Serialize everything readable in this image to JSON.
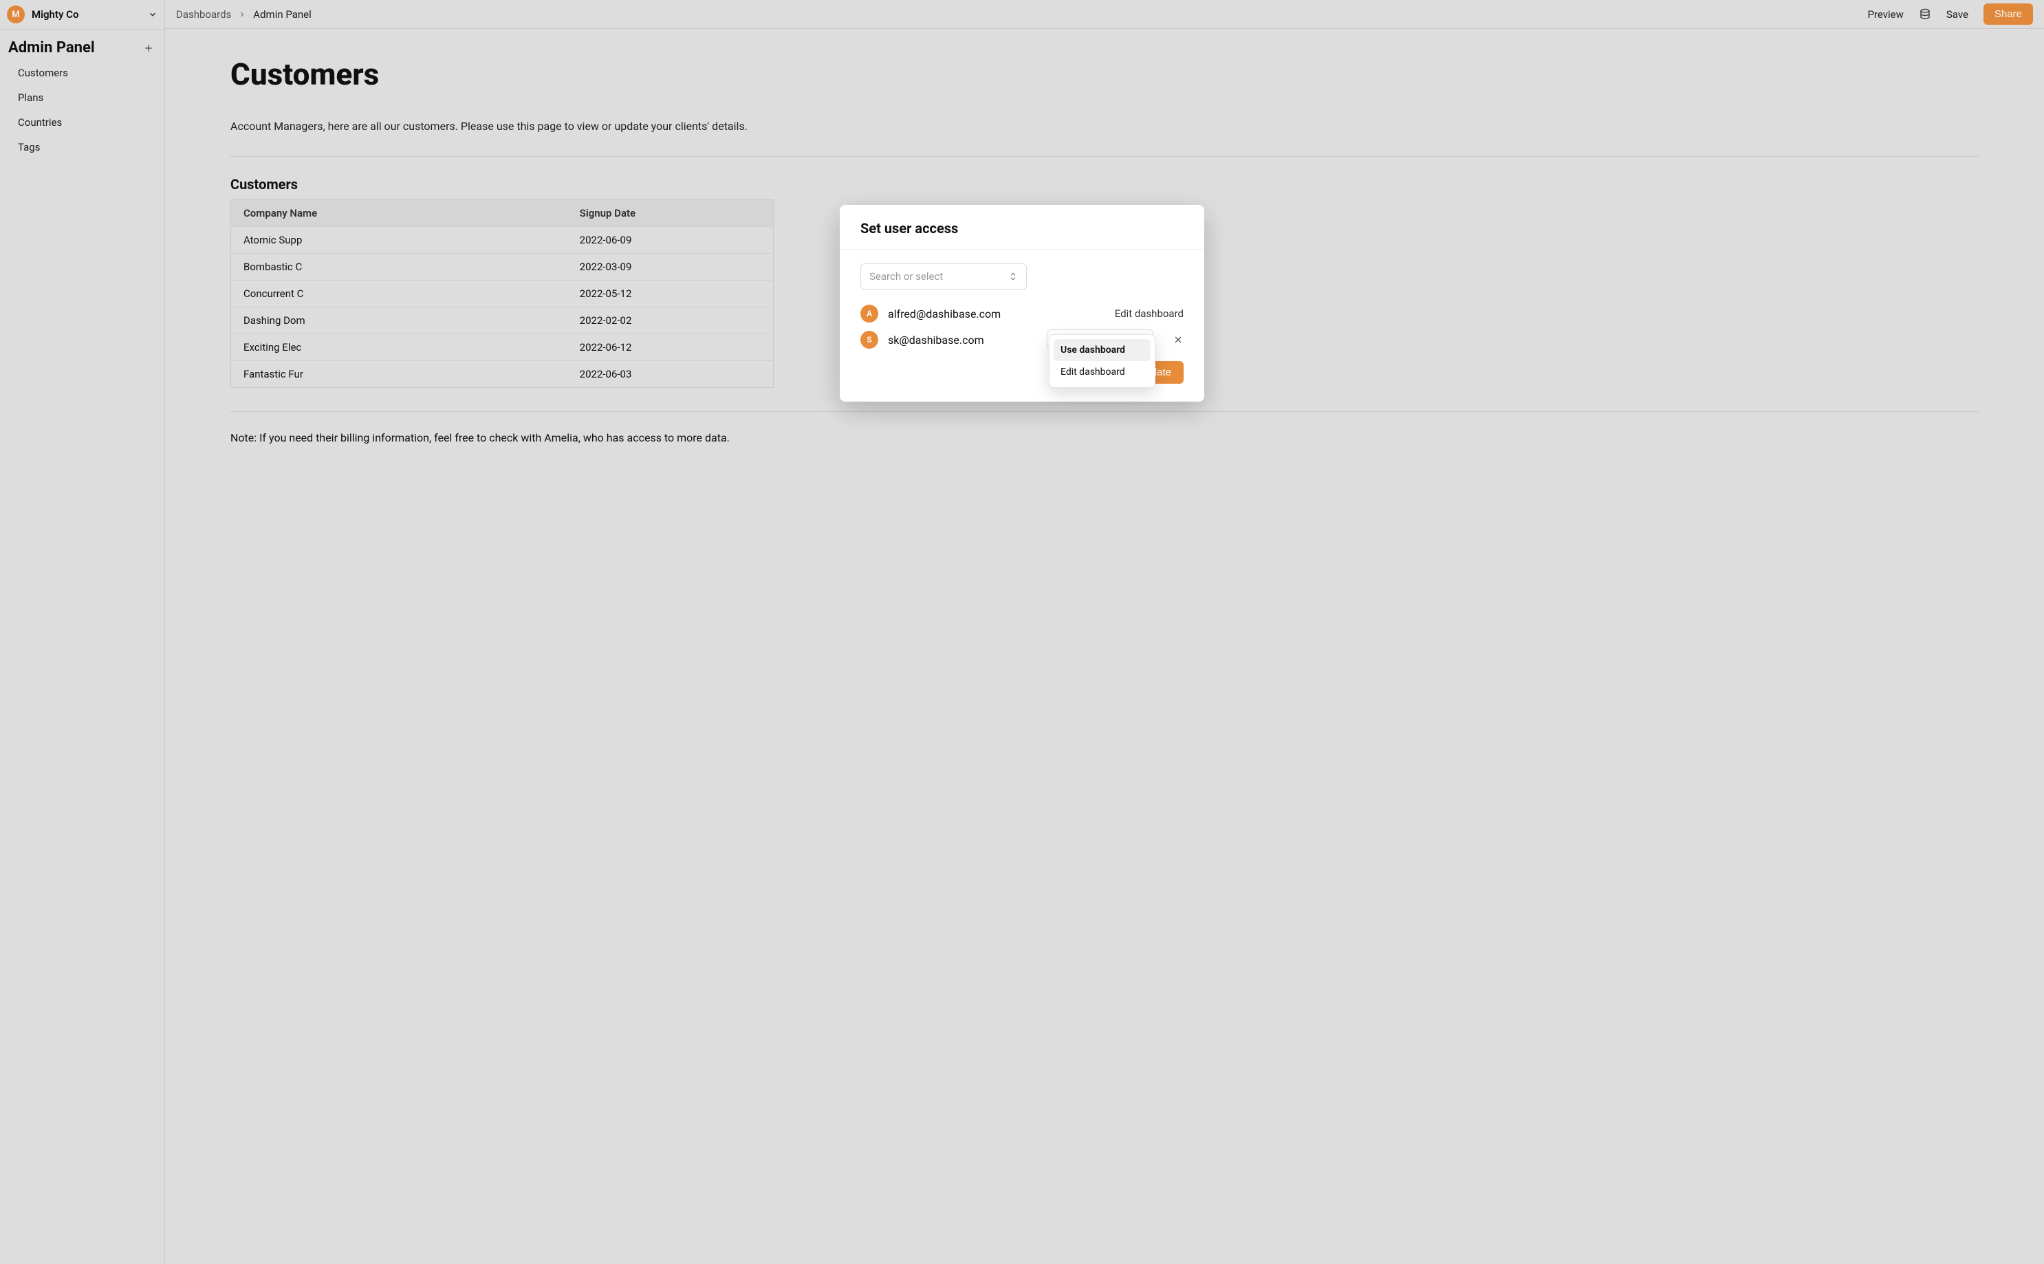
{
  "workspace": {
    "initial": "M",
    "name": "Mighty Co"
  },
  "sidebar": {
    "title": "Admin Panel",
    "items": [
      "Customers",
      "Plans",
      "Countries",
      "Tags"
    ]
  },
  "breadcrumb": {
    "root": "Dashboards",
    "current": "Admin Panel"
  },
  "topbar": {
    "preview": "Preview",
    "save": "Save",
    "share": "Share"
  },
  "page": {
    "title": "Customers",
    "intro": "Account Managers, here are all our customers. Please use this page to view or update your clients' details.",
    "section": "Customers",
    "note": "Note: If you need their billing information, feel free to check with Amelia, who has access to more data."
  },
  "table": {
    "columns": [
      "Company Name",
      "Signup Date"
    ],
    "rows": [
      {
        "company": "Atomic Supp",
        "date": "2022-06-09"
      },
      {
        "company": "Bombastic C",
        "date": "2022-03-09"
      },
      {
        "company": "Concurrent C",
        "date": "2022-05-12"
      },
      {
        "company": "Dashing Dom",
        "date": "2022-02-02"
      },
      {
        "company": "Exciting Elec",
        "date": "2022-06-12"
      },
      {
        "company": "Fantastic Fur",
        "date": "2022-06-03"
      }
    ]
  },
  "modal": {
    "title": "Set user access",
    "search_placeholder": "Search or select",
    "users": [
      {
        "initial": "A",
        "email": "alfred@dashibase.com",
        "role": "Edit dashboard",
        "dropdown_open": false
      },
      {
        "initial": "S",
        "email": "sk@dashibase.com",
        "role": "Use dashboard",
        "dropdown_open": true
      }
    ],
    "update": "Update",
    "dropdown_options": [
      "Use dashboard",
      "Edit dashboard"
    ],
    "dropdown_selected": "Use dashboard"
  }
}
